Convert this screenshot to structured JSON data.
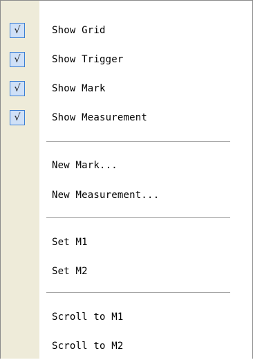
{
  "menu": {
    "check_glyph": "√",
    "items": [
      {
        "label": "Show Grid",
        "checked": true
      },
      {
        "label": "Show Trigger",
        "checked": true
      },
      {
        "label": "Show Mark",
        "checked": true
      },
      {
        "label": "Show Measurement",
        "checked": true
      },
      {
        "label": "New Mark..."
      },
      {
        "label": "New Measurement..."
      },
      {
        "label": "Set M1"
      },
      {
        "label": "Set M2"
      },
      {
        "label": "Scroll to M1"
      },
      {
        "label": "Scroll to M2"
      }
    ]
  },
  "colors": {
    "gutter": "#eeebd9",
    "check_fill": "#cfe0f7",
    "check_border": "#3c7fd3"
  }
}
